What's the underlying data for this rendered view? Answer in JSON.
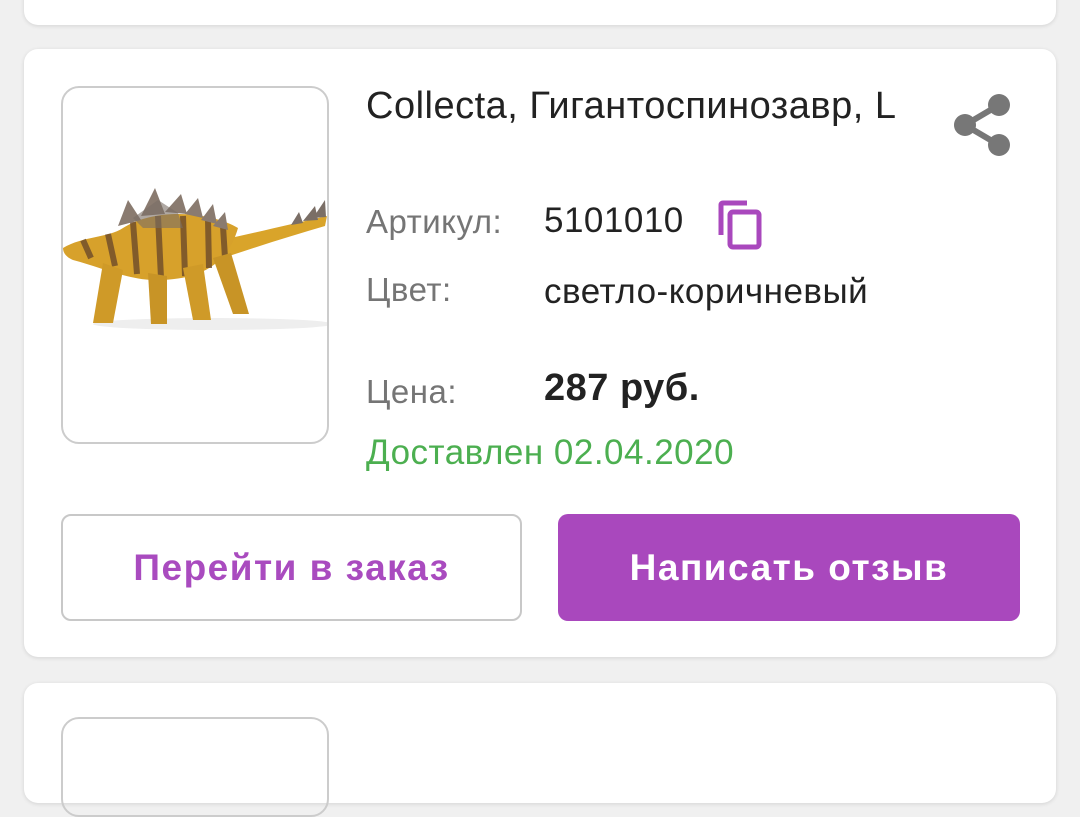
{
  "product": {
    "title": "Collecta, Гигантоспинозавр, L",
    "sku_label": "Артикул:",
    "sku_value": "5101010",
    "color_label": "Цвет:",
    "color_value": "светло-коричневый",
    "price_label": "Цена:",
    "price_value": "287 руб.",
    "status": "Доставлен 02.04.2020"
  },
  "actions": {
    "go_to_order": "Перейти в заказ",
    "write_review": "Написать отзыв"
  },
  "icons": {
    "share": "share-icon",
    "copy": "copy-icon"
  },
  "colors": {
    "accent": "#a948bd",
    "status_green": "#4caf50"
  }
}
